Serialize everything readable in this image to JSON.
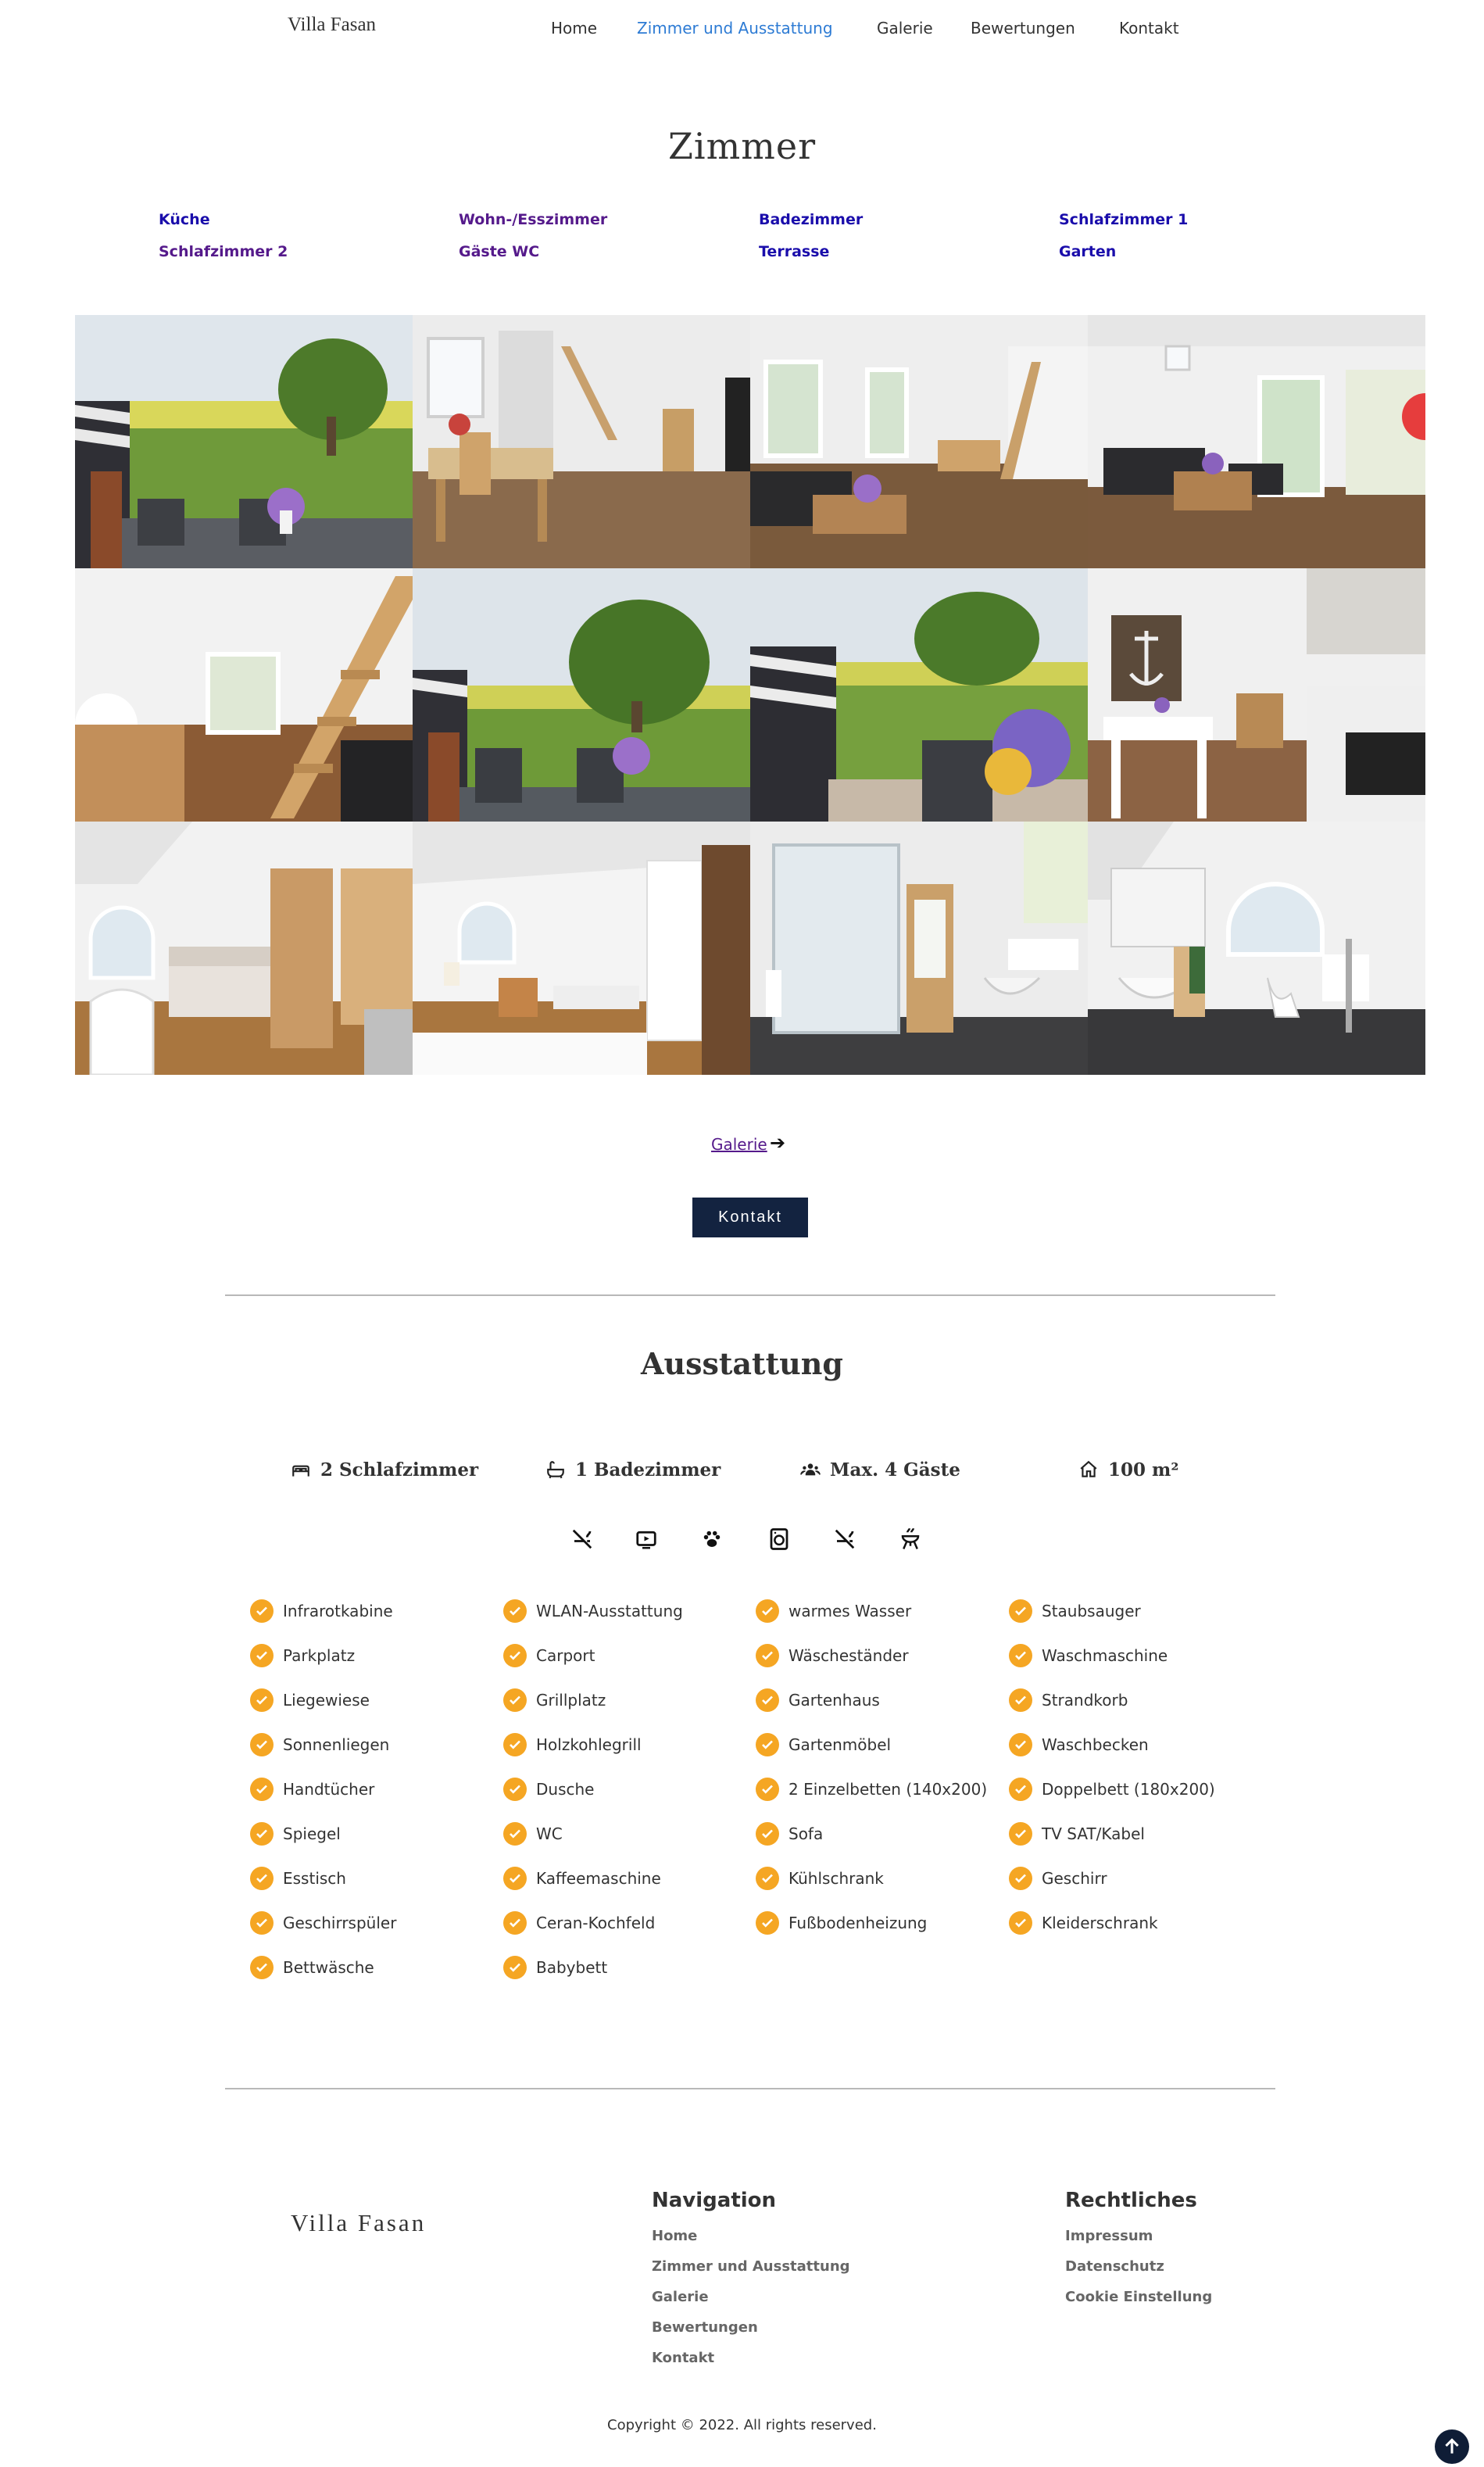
{
  "header": {
    "logo": "Villa Fasan",
    "nav": [
      "Home",
      "Zimmer und Ausstattung",
      "Galerie",
      "Bewertungen",
      "Kontakt"
    ],
    "active": "Zimmer und Ausstattung"
  },
  "rooms": {
    "title": "Zimmer",
    "links": [
      "Küche",
      "Wohn-/Esszimmer",
      "Badezimmer",
      "Schlafzimmer 1",
      "Schlafzimmer 2",
      "Gäste WC",
      "Terrasse",
      "Garten"
    ],
    "photos": [
      "Garten mit Strandkorb",
      "Wohn-/Esszimmer",
      "Wohnzimmer mit Treppe",
      "Wohnzimmer",
      "Treppe",
      "Garten",
      "Terrasse",
      "Küche",
      "Schlafzimmer 1",
      "Schlafzimmer 2",
      "Badezimmer Dusche",
      "Badezimmer"
    ],
    "gallery_link": "Galerie",
    "contact_button": "Kontakt"
  },
  "amenities": {
    "title": "Ausstattung",
    "facts": [
      {
        "icon": "bed-icon",
        "label": "2 Schlafzimmer"
      },
      {
        "icon": "bathtub-icon",
        "label": "1 Badezimmer"
      },
      {
        "icon": "guests-icon",
        "label": "Max. 4 Gäste"
      },
      {
        "icon": "home-icon",
        "label": "100 m²"
      }
    ],
    "icons": [
      "no-smoking-icon",
      "tv-icon",
      "pets-icon",
      "washing-machine-icon",
      "no-smoking-icon",
      "grill-icon"
    ],
    "features": [
      [
        "Infrarotkabine",
        "Parkplatz",
        "Liegewiese",
        "Sonnenliegen",
        "Handtücher",
        "Spiegel",
        "Esstisch",
        "Geschirrspüler",
        "Bettwäsche"
      ],
      [
        "WLAN-Ausstattung",
        "Carport",
        "Grillplatz",
        "Holzkohlegrill",
        "Dusche",
        "WC",
        "Kaffeemaschine",
        "Ceran-Kochfeld",
        "Babybett"
      ],
      [
        "warmes Wasser",
        "Wäscheständer",
        "Gartenhaus",
        "Gartenmöbel",
        "2 Einzelbetten (140x200)",
        "Sofa",
        "Kühlschrank",
        "Fußbodenheizung"
      ],
      [
        "Staubsauger",
        "Waschmaschine",
        "Strandkorb",
        "Waschbecken",
        "Doppelbett (180x200)",
        "TV SAT/Kabel",
        "Geschirr",
        "Kleiderschrank"
      ]
    ],
    "colors": {
      "check": "#f5a623"
    }
  },
  "footer": {
    "logo": "Villa Fasan",
    "navigation_title": "Navigation",
    "navigation": [
      "Home",
      "Zimmer und Ausstattung",
      "Galerie",
      "Bewertungen",
      "Kontakt"
    ],
    "legal_title": "Rechtliches",
    "legal": [
      "Impressum",
      "Datenschutz",
      "Cookie Einstellung"
    ],
    "copyright": "Copyright © 2022. All rights reserved."
  },
  "colors": {
    "nav_active": "#2d7bd4",
    "button_bg": "#132340",
    "link": "#1a0dab",
    "link_visited": "#551a8b"
  }
}
